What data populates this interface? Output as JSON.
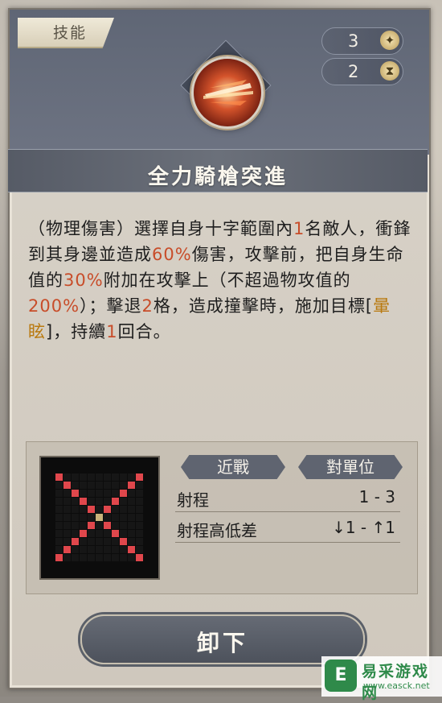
{
  "tab": {
    "label": "技能"
  },
  "stats": {
    "cost": {
      "value": "3",
      "icon": "star-icon"
    },
    "cooldown": {
      "value": "2",
      "icon": "hourglass-icon"
    }
  },
  "skill": {
    "name": "全力騎槍突進",
    "description": [
      {
        "text": "（物理傷害）選擇自身十字範圍內",
        "style": "normal"
      },
      {
        "text": "1",
        "style": "red"
      },
      {
        "text": "名敵人，衝鋒到其身邊並造成",
        "style": "normal"
      },
      {
        "text": "60%",
        "style": "red"
      },
      {
        "text": "傷害，攻擊前，把自身生命值的",
        "style": "normal"
      },
      {
        "text": "30%",
        "style": "red"
      },
      {
        "text": "附加在攻擊上（不超過物攻值的",
        "style": "normal"
      },
      {
        "text": "200%",
        "style": "red"
      },
      {
        "text": "）；擊退",
        "style": "normal"
      },
      {
        "text": "2",
        "style": "red"
      },
      {
        "text": "格，造成撞擊時，施加目標[",
        "style": "normal"
      },
      {
        "text": "暈眩",
        "style": "gold"
      },
      {
        "text": "]，持續",
        "style": "normal"
      },
      {
        "text": "1",
        "style": "red"
      },
      {
        "text": "回合。",
        "style": "normal"
      }
    ]
  },
  "range_info": {
    "type_tag": "近戰",
    "target_tag": "對單位",
    "rows": [
      {
        "label": "射程",
        "value": "1 - 3"
      },
      {
        "label": "射程高低差",
        "value": "↓1 - ↑1"
      }
    ]
  },
  "button": {
    "label": "卸下"
  },
  "watermark": {
    "logo": "E",
    "cn": "易采游戏网",
    "en": "www.easck.net"
  },
  "colors": {
    "accent_red": "#c84d2a",
    "accent_gold": "#b97a10",
    "grid_red": "#e0474c",
    "grid_center": "#c9b27a"
  }
}
